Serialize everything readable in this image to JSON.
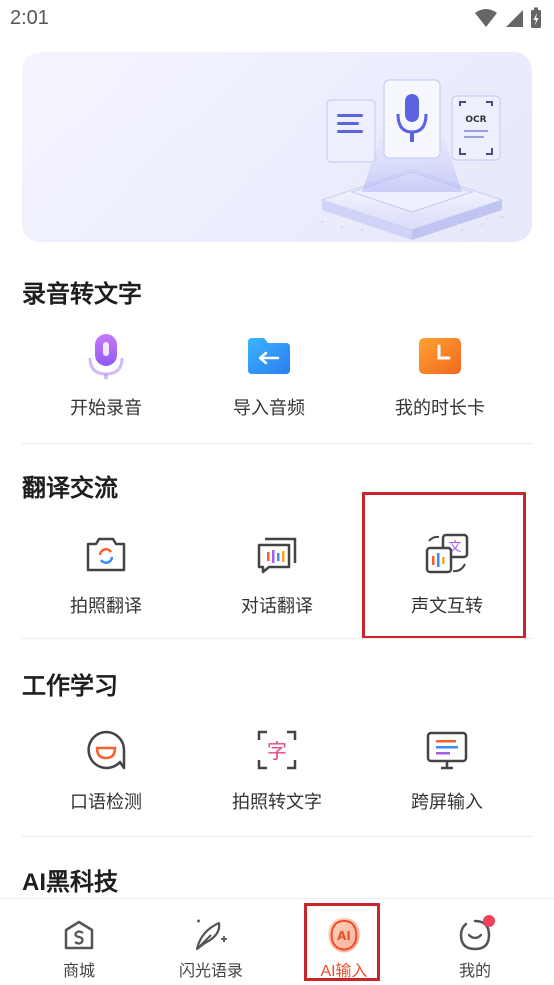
{
  "status": {
    "time": "2:01"
  },
  "sections": [
    {
      "title": "录音转文字",
      "items": [
        {
          "label": "开始录音",
          "icon": "microphone-icon"
        },
        {
          "label": "导入音频",
          "icon": "folder-import-icon"
        },
        {
          "label": "我的时长卡",
          "icon": "clock-card-icon"
        }
      ]
    },
    {
      "title": "翻译交流",
      "items": [
        {
          "label": "拍照翻译",
          "icon": "camera-translate-icon"
        },
        {
          "label": "对话翻译",
          "icon": "dialogue-translate-icon"
        },
        {
          "label": "声文互转",
          "icon": "voice-text-convert-icon"
        }
      ]
    },
    {
      "title": "工作学习",
      "items": [
        {
          "label": "口语检测",
          "icon": "speech-check-icon"
        },
        {
          "label": "拍照转文字",
          "icon": "photo-to-text-icon"
        },
        {
          "label": "跨屏输入",
          "icon": "cross-screen-input-icon"
        }
      ]
    },
    {
      "title": "AI黑科技",
      "items": []
    }
  ],
  "banner": {
    "ocr_text": "OCR"
  },
  "tabbar": [
    {
      "label": "商城",
      "icon": "shop-icon"
    },
    {
      "label": "闪光语录",
      "icon": "quill-icon"
    },
    {
      "label": "AI输入",
      "icon": "ai-icon",
      "icon_text": "AI",
      "active": true
    },
    {
      "label": "我的",
      "icon": "profile-icon"
    }
  ],
  "colors": {
    "accent": "#e8502d",
    "highlight": "#c8262b"
  }
}
